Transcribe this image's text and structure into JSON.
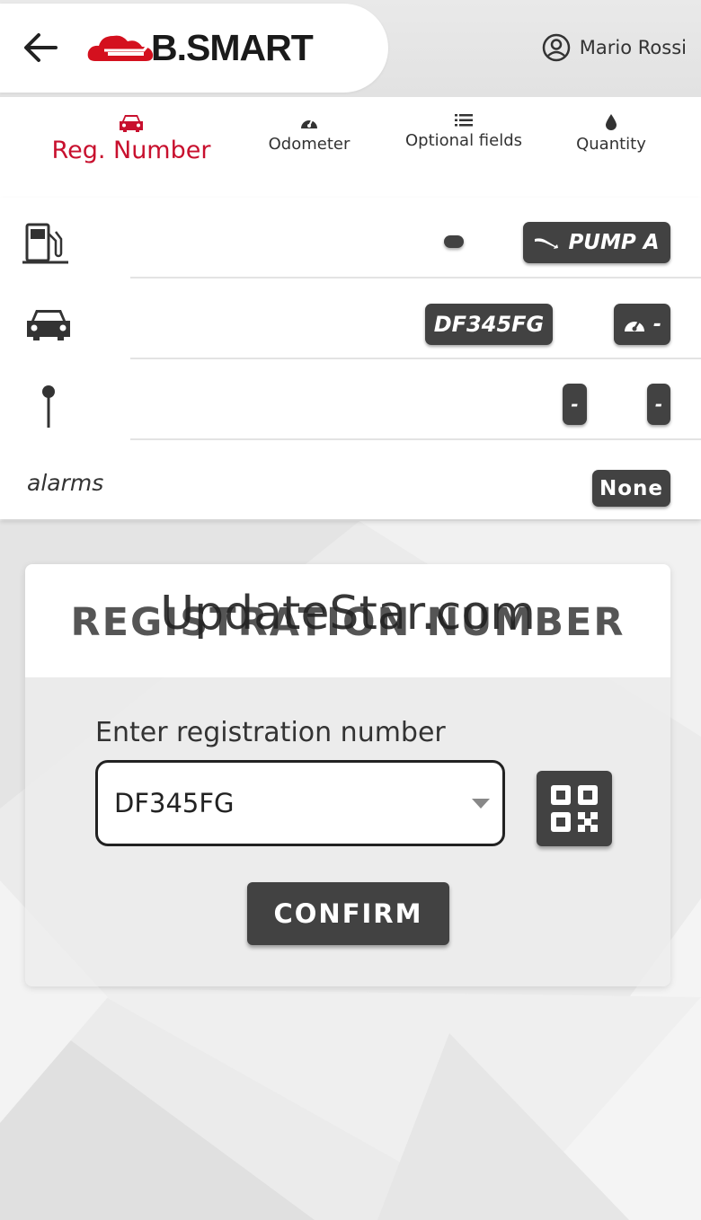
{
  "header": {
    "brand": "B.SMART",
    "user_name": "Mario Rossi"
  },
  "tabs": [
    {
      "label": "Reg. Number",
      "icon": "car-icon",
      "active": true
    },
    {
      "label": "Odometer",
      "icon": "gauge-icon",
      "active": false
    },
    {
      "label": "Optional fields",
      "icon": "list-icon",
      "active": false
    },
    {
      "label": "Quantity",
      "icon": "drop-icon",
      "active": false
    }
  ],
  "info": {
    "pump_indicator": "",
    "pump_label": "PUMP A",
    "vehicle_plate": "DF345FG",
    "vehicle_odometer": "-",
    "location_value_1": "-",
    "location_value_2": "-",
    "alarms_label": "alarms",
    "alarms_value": "None"
  },
  "card": {
    "title": "REGISTRATION NUMBER",
    "watermark": "UpdateStar.com",
    "field_label": "Enter registration number",
    "input_value": "DF345FG",
    "confirm_label": "CONFIRM"
  },
  "colors": {
    "accent": "#c8102e",
    "chip_bg": "#424242",
    "text": "#333333"
  }
}
